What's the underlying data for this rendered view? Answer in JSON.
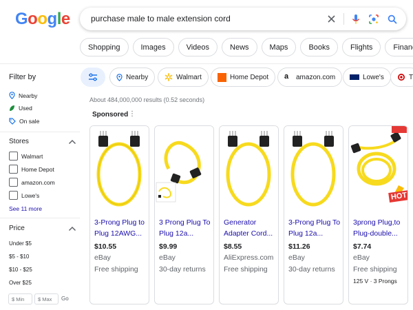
{
  "header": {
    "logo": [
      "G",
      "o",
      "o",
      "g",
      "l",
      "e"
    ],
    "logo_colors": [
      "#4285F4",
      "#EA4335",
      "#FBBC05",
      "#4285F4",
      "#34A853",
      "#EA4335"
    ],
    "query": "purchase male to male extension cord"
  },
  "tabs": [
    "Shopping",
    "Images",
    "Videos",
    "News",
    "Maps",
    "Books",
    "Flights",
    "Finance"
  ],
  "sidebar": {
    "filter_by": "Filter by",
    "filters": [
      "Nearby",
      "Used",
      "On sale"
    ],
    "stores_heading": "Stores",
    "stores": [
      "Walmart",
      "Home Depot",
      "amazon.com",
      "Lowe's"
    ],
    "see_more": "See 11 more",
    "price_heading": "Price",
    "prices": [
      "Under $5",
      "$5 - $10",
      "$10 - $25",
      "Over $25"
    ],
    "min_placeholder": "$ Min",
    "max_placeholder": "$ Max",
    "go": "Go"
  },
  "chips": {
    "nearby": "Nearby",
    "walmart": "Walmart",
    "homedepot": "Home Depot",
    "amazon": "amazon.com",
    "lowes": "Lowe's",
    "target": "T"
  },
  "results_count": "About 484,000,000 results (0.52 seconds)",
  "sponsored": "Sponsored",
  "products": [
    {
      "title": "3-Prong Plug to Plug 12AWG...",
      "price": "$10.55",
      "store": "eBay",
      "shipping": "Free shipping",
      "extra": ""
    },
    {
      "title": "3 Prong Plug To Plug 12a...",
      "price": "$9.99",
      "store": "eBay",
      "shipping": "30-day returns",
      "extra": ""
    },
    {
      "title": "Generator Adapter Cord...",
      "price": "$8.55",
      "store": "AliExpress.com",
      "shipping": "Free shipping",
      "extra": ""
    },
    {
      "title": "3-Prong Plug To Plug 12a...",
      "price": "$11.26",
      "store": "eBay",
      "shipping": "30-day returns",
      "extra": ""
    },
    {
      "title": "3prong Plug,to Plug-double...",
      "price": "$7.74",
      "store": "eBay",
      "shipping": "Free shipping",
      "extra": "125 V · 3 Prongs"
    }
  ],
  "hot_badge": "HOT",
  "colors": {
    "link": "#1a0dab",
    "cord": "#F7DA1E",
    "accent": "#1a73e8"
  }
}
